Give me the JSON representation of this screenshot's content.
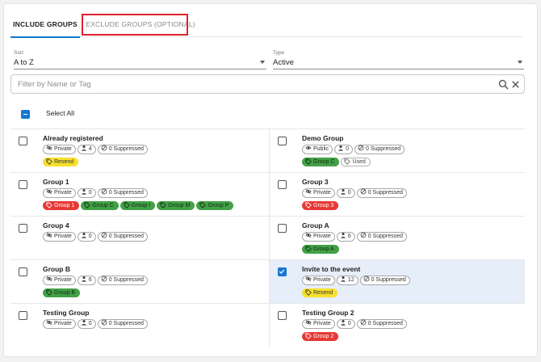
{
  "tabs": {
    "include": "INCLUDE GROUPS",
    "exclude": "EXCLUDE GROUPS (OPTIONAL)"
  },
  "sort": {
    "label": "Sort",
    "value": "A to Z"
  },
  "type": {
    "label": "Type",
    "value": "Active"
  },
  "filter": {
    "placeholder": "Filter by Name or Tag"
  },
  "select_all": "Select All",
  "colors": {
    "accent": "#1976d2",
    "highlight": "#e0212b",
    "tag_red": "#e53935",
    "tag_green": "#43a047",
    "tag_yellow": "#f7e02d"
  },
  "groups": [
    {
      "name": "Already registered",
      "visibility": "Private",
      "visibility_icon": "eye-off-icon",
      "members": "4",
      "suppressed": "0 Suppressed",
      "checked": false,
      "tags": [
        {
          "label": "Resend",
          "color": "yellow"
        }
      ]
    },
    {
      "name": "Demo Group",
      "visibility": "Public",
      "visibility_icon": "eye-icon",
      "members": "0",
      "suppressed": "0 Suppressed",
      "checked": false,
      "tags": [
        {
          "label": "Group C",
          "color": "green"
        },
        {
          "label": "Used",
          "color": "outline"
        }
      ]
    },
    {
      "name": "Group 1",
      "visibility": "Private",
      "visibility_icon": "eye-off-icon",
      "members": "0",
      "suppressed": "0 Suppressed",
      "checked": false,
      "tags": [
        {
          "label": "Group 1",
          "color": "red"
        },
        {
          "label": "Group C",
          "color": "green"
        },
        {
          "label": "Group I",
          "color": "green"
        },
        {
          "label": "Group M",
          "color": "green"
        },
        {
          "label": "Group P",
          "color": "green"
        }
      ]
    },
    {
      "name": "Group 3",
      "visibility": "Private",
      "visibility_icon": "eye-off-icon",
      "members": "0",
      "suppressed": "0 Suppressed",
      "checked": false,
      "tags": [
        {
          "label": "Group 3",
          "color": "red"
        }
      ]
    },
    {
      "name": "Group 4",
      "visibility": "Private",
      "visibility_icon": "eye-off-icon",
      "members": "0",
      "suppressed": "0 Suppressed",
      "checked": false,
      "tags": []
    },
    {
      "name": "Group A",
      "visibility": "Private",
      "visibility_icon": "eye-off-icon",
      "members": "6",
      "suppressed": "0 Suppressed",
      "checked": false,
      "tags": [
        {
          "label": "Group A",
          "color": "green"
        }
      ]
    },
    {
      "name": "Group B",
      "visibility": "Private",
      "visibility_icon": "eye-off-icon",
      "members": "6",
      "suppressed": "0 Suppressed",
      "checked": false,
      "tags": [
        {
          "label": "Group B",
          "color": "green"
        }
      ]
    },
    {
      "name": "Invite to the event",
      "visibility": "Private",
      "visibility_icon": "eye-off-icon",
      "members": "12",
      "suppressed": "0 Suppressed",
      "checked": true,
      "tags": [
        {
          "label": "Resend",
          "color": "yellow"
        }
      ]
    },
    {
      "name": "Testing Group",
      "visibility": "Private",
      "visibility_icon": "eye-off-icon",
      "members": "0",
      "suppressed": "0 Suppressed",
      "checked": false,
      "tags": []
    },
    {
      "name": "Testing Group 2",
      "visibility": "Private",
      "visibility_icon": "eye-off-icon",
      "members": "0",
      "suppressed": "0 Suppressed",
      "checked": false,
      "tags": [
        {
          "label": "Group 2",
          "color": "red"
        }
      ]
    }
  ]
}
